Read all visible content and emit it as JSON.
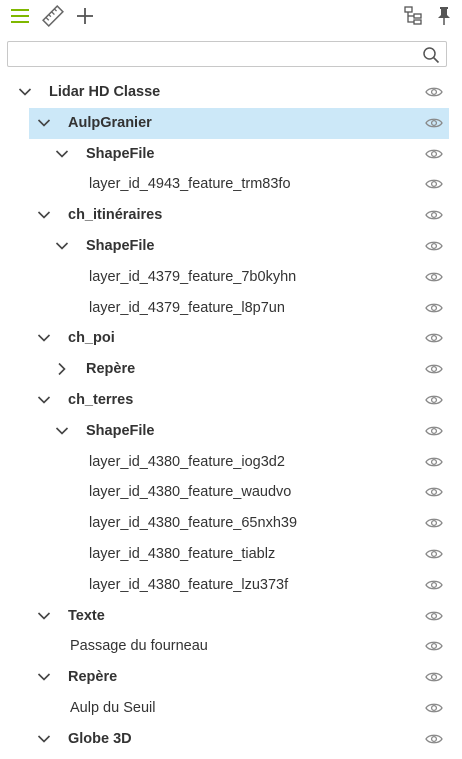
{
  "colors": {
    "accent": "#7fb800",
    "selection": "#cce8f8",
    "icon": "#666666"
  },
  "toolbar": {
    "menu_icon": "hamburger-menu-icon",
    "ruler_icon": "ruler-icon",
    "add_icon": "plus-icon",
    "tree_icon": "tree-structure-icon",
    "pin_icon": "pin-icon"
  },
  "search": {
    "value": "",
    "placeholder": "",
    "icon": "search-icon"
  },
  "tree": [
    {
      "label": "Lidar HD Classe",
      "level": 0,
      "chevron": "down",
      "bold": true,
      "selected": false
    },
    {
      "label": "AulpGranier",
      "level": 1,
      "chevron": "down",
      "bold": true,
      "selected": true
    },
    {
      "label": "ShapeFile",
      "level": 2,
      "chevron": "down",
      "bold": true,
      "selected": false
    },
    {
      "label": "layer_id_4943_feature_trm83fo",
      "level": 3,
      "chevron": "none",
      "bold": false,
      "selected": false
    },
    {
      "label": "ch_itinéraires",
      "level": 1,
      "chevron": "down",
      "bold": true,
      "selected": false
    },
    {
      "label": "ShapeFile",
      "level": 2,
      "chevron": "down",
      "bold": true,
      "selected": false
    },
    {
      "label": "layer_id_4379_feature_7b0kyhn",
      "level": 3,
      "chevron": "none",
      "bold": false,
      "selected": false
    },
    {
      "label": "layer_id_4379_feature_l8p7un",
      "level": 3,
      "chevron": "none",
      "bold": false,
      "selected": false
    },
    {
      "label": "ch_poi",
      "level": 1,
      "chevron": "down",
      "bold": true,
      "selected": false
    },
    {
      "label": "Repère",
      "level": 2,
      "chevron": "right",
      "bold": true,
      "selected": false
    },
    {
      "label": "ch_terres",
      "level": 1,
      "chevron": "down",
      "bold": true,
      "selected": false
    },
    {
      "label": "ShapeFile",
      "level": 2,
      "chevron": "down",
      "bold": true,
      "selected": false
    },
    {
      "label": "layer_id_4380_feature_iog3d2",
      "level": 3,
      "chevron": "none",
      "bold": false,
      "selected": false
    },
    {
      "label": "layer_id_4380_feature_waudvo",
      "level": 3,
      "chevron": "none",
      "bold": false,
      "selected": false
    },
    {
      "label": "layer_id_4380_feature_65nxh39",
      "level": 3,
      "chevron": "none",
      "bold": false,
      "selected": false
    },
    {
      "label": "layer_id_4380_feature_tiablz",
      "level": 3,
      "chevron": "none",
      "bold": false,
      "selected": false
    },
    {
      "label": "layer_id_4380_feature_lzu373f",
      "level": 3,
      "chevron": "none",
      "bold": false,
      "selected": false
    },
    {
      "label": "Texte",
      "level": 1,
      "chevron": "down",
      "bold": true,
      "selected": false
    },
    {
      "label": "Passage du fourneau",
      "level": 2,
      "chevron": "none",
      "bold": false,
      "selected": false
    },
    {
      "label": "Repère",
      "level": 1,
      "chevron": "down",
      "bold": true,
      "selected": false
    },
    {
      "label": "Aulp du Seuil",
      "level": 2,
      "chevron": "none",
      "bold": false,
      "selected": false
    },
    {
      "label": "Globe 3D",
      "level": 1,
      "chevron": "down",
      "bold": true,
      "selected": false
    }
  ]
}
